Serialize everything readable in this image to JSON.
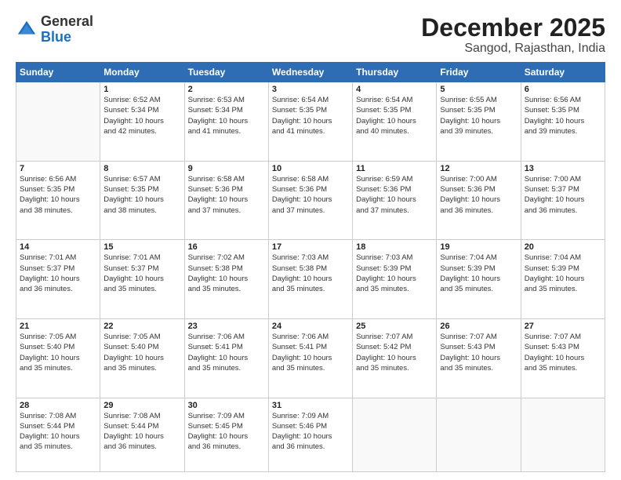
{
  "logo": {
    "general": "General",
    "blue": "Blue"
  },
  "header": {
    "month": "December 2025",
    "location": "Sangod, Rajasthan, India"
  },
  "weekdays": [
    "Sunday",
    "Monday",
    "Tuesday",
    "Wednesday",
    "Thursday",
    "Friday",
    "Saturday"
  ],
  "weeks": [
    [
      {
        "day": "",
        "empty": true
      },
      {
        "day": "1",
        "sunrise": "Sunrise: 6:52 AM",
        "sunset": "Sunset: 5:34 PM",
        "daylight": "Daylight: 10 hours",
        "daylight2": "and 42 minutes."
      },
      {
        "day": "2",
        "sunrise": "Sunrise: 6:53 AM",
        "sunset": "Sunset: 5:34 PM",
        "daylight": "Daylight: 10 hours",
        "daylight2": "and 41 minutes."
      },
      {
        "day": "3",
        "sunrise": "Sunrise: 6:54 AM",
        "sunset": "Sunset: 5:35 PM",
        "daylight": "Daylight: 10 hours",
        "daylight2": "and 41 minutes."
      },
      {
        "day": "4",
        "sunrise": "Sunrise: 6:54 AM",
        "sunset": "Sunset: 5:35 PM",
        "daylight": "Daylight: 10 hours",
        "daylight2": "and 40 minutes."
      },
      {
        "day": "5",
        "sunrise": "Sunrise: 6:55 AM",
        "sunset": "Sunset: 5:35 PM",
        "daylight": "Daylight: 10 hours",
        "daylight2": "and 39 minutes."
      },
      {
        "day": "6",
        "sunrise": "Sunrise: 6:56 AM",
        "sunset": "Sunset: 5:35 PM",
        "daylight": "Daylight: 10 hours",
        "daylight2": "and 39 minutes."
      }
    ],
    [
      {
        "day": "7",
        "sunrise": "Sunrise: 6:56 AM",
        "sunset": "Sunset: 5:35 PM",
        "daylight": "Daylight: 10 hours",
        "daylight2": "and 38 minutes."
      },
      {
        "day": "8",
        "sunrise": "Sunrise: 6:57 AM",
        "sunset": "Sunset: 5:35 PM",
        "daylight": "Daylight: 10 hours",
        "daylight2": "and 38 minutes."
      },
      {
        "day": "9",
        "sunrise": "Sunrise: 6:58 AM",
        "sunset": "Sunset: 5:36 PM",
        "daylight": "Daylight: 10 hours",
        "daylight2": "and 37 minutes."
      },
      {
        "day": "10",
        "sunrise": "Sunrise: 6:58 AM",
        "sunset": "Sunset: 5:36 PM",
        "daylight": "Daylight: 10 hours",
        "daylight2": "and 37 minutes."
      },
      {
        "day": "11",
        "sunrise": "Sunrise: 6:59 AM",
        "sunset": "Sunset: 5:36 PM",
        "daylight": "Daylight: 10 hours",
        "daylight2": "and 37 minutes."
      },
      {
        "day": "12",
        "sunrise": "Sunrise: 7:00 AM",
        "sunset": "Sunset: 5:36 PM",
        "daylight": "Daylight: 10 hours",
        "daylight2": "and 36 minutes."
      },
      {
        "day": "13",
        "sunrise": "Sunrise: 7:00 AM",
        "sunset": "Sunset: 5:37 PM",
        "daylight": "Daylight: 10 hours",
        "daylight2": "and 36 minutes."
      }
    ],
    [
      {
        "day": "14",
        "sunrise": "Sunrise: 7:01 AM",
        "sunset": "Sunset: 5:37 PM",
        "daylight": "Daylight: 10 hours",
        "daylight2": "and 36 minutes."
      },
      {
        "day": "15",
        "sunrise": "Sunrise: 7:01 AM",
        "sunset": "Sunset: 5:37 PM",
        "daylight": "Daylight: 10 hours",
        "daylight2": "and 35 minutes."
      },
      {
        "day": "16",
        "sunrise": "Sunrise: 7:02 AM",
        "sunset": "Sunset: 5:38 PM",
        "daylight": "Daylight: 10 hours",
        "daylight2": "and 35 minutes."
      },
      {
        "day": "17",
        "sunrise": "Sunrise: 7:03 AM",
        "sunset": "Sunset: 5:38 PM",
        "daylight": "Daylight: 10 hours",
        "daylight2": "and 35 minutes."
      },
      {
        "day": "18",
        "sunrise": "Sunrise: 7:03 AM",
        "sunset": "Sunset: 5:39 PM",
        "daylight": "Daylight: 10 hours",
        "daylight2": "and 35 minutes."
      },
      {
        "day": "19",
        "sunrise": "Sunrise: 7:04 AM",
        "sunset": "Sunset: 5:39 PM",
        "daylight": "Daylight: 10 hours",
        "daylight2": "and 35 minutes."
      },
      {
        "day": "20",
        "sunrise": "Sunrise: 7:04 AM",
        "sunset": "Sunset: 5:39 PM",
        "daylight": "Daylight: 10 hours",
        "daylight2": "and 35 minutes."
      }
    ],
    [
      {
        "day": "21",
        "sunrise": "Sunrise: 7:05 AM",
        "sunset": "Sunset: 5:40 PM",
        "daylight": "Daylight: 10 hours",
        "daylight2": "and 35 minutes."
      },
      {
        "day": "22",
        "sunrise": "Sunrise: 7:05 AM",
        "sunset": "Sunset: 5:40 PM",
        "daylight": "Daylight: 10 hours",
        "daylight2": "and 35 minutes."
      },
      {
        "day": "23",
        "sunrise": "Sunrise: 7:06 AM",
        "sunset": "Sunset: 5:41 PM",
        "daylight": "Daylight: 10 hours",
        "daylight2": "and 35 minutes."
      },
      {
        "day": "24",
        "sunrise": "Sunrise: 7:06 AM",
        "sunset": "Sunset: 5:41 PM",
        "daylight": "Daylight: 10 hours",
        "daylight2": "and 35 minutes."
      },
      {
        "day": "25",
        "sunrise": "Sunrise: 7:07 AM",
        "sunset": "Sunset: 5:42 PM",
        "daylight": "Daylight: 10 hours",
        "daylight2": "and 35 minutes."
      },
      {
        "day": "26",
        "sunrise": "Sunrise: 7:07 AM",
        "sunset": "Sunset: 5:43 PM",
        "daylight": "Daylight: 10 hours",
        "daylight2": "and 35 minutes."
      },
      {
        "day": "27",
        "sunrise": "Sunrise: 7:07 AM",
        "sunset": "Sunset: 5:43 PM",
        "daylight": "Daylight: 10 hours",
        "daylight2": "and 35 minutes."
      }
    ],
    [
      {
        "day": "28",
        "sunrise": "Sunrise: 7:08 AM",
        "sunset": "Sunset: 5:44 PM",
        "daylight": "Daylight: 10 hours",
        "daylight2": "and 35 minutes."
      },
      {
        "day": "29",
        "sunrise": "Sunrise: 7:08 AM",
        "sunset": "Sunset: 5:44 PM",
        "daylight": "Daylight: 10 hours",
        "daylight2": "and 36 minutes."
      },
      {
        "day": "30",
        "sunrise": "Sunrise: 7:09 AM",
        "sunset": "Sunset: 5:45 PM",
        "daylight": "Daylight: 10 hours",
        "daylight2": "and 36 minutes."
      },
      {
        "day": "31",
        "sunrise": "Sunrise: 7:09 AM",
        "sunset": "Sunset: 5:46 PM",
        "daylight": "Daylight: 10 hours",
        "daylight2": "and 36 minutes."
      },
      {
        "day": "",
        "empty": true
      },
      {
        "day": "",
        "empty": true
      },
      {
        "day": "",
        "empty": true
      }
    ]
  ]
}
